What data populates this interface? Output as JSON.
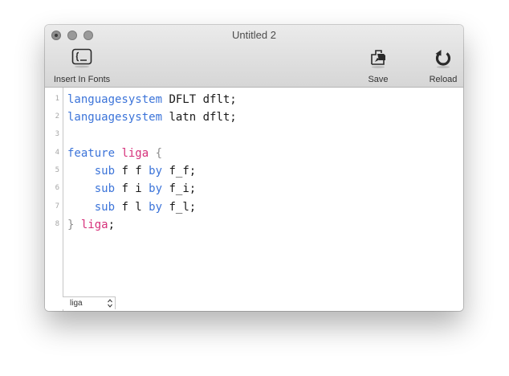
{
  "window": {
    "title": "Untitled 2"
  },
  "toolbar": {
    "insert_label": "Insert In Fonts",
    "save_label": "Save",
    "reload_label": "Reload"
  },
  "editor": {
    "line_numbers": [
      "1",
      "2",
      "3",
      "4",
      "5",
      "6",
      "7",
      "8"
    ],
    "lines": [
      [
        {
          "t": "languagesystem",
          "c": "kw"
        },
        {
          "t": " DFLT dflt;",
          "c": ""
        }
      ],
      [
        {
          "t": "languagesystem",
          "c": "kw"
        },
        {
          "t": " latn dflt;",
          "c": ""
        }
      ],
      [],
      [
        {
          "t": "feature",
          "c": "kw"
        },
        {
          "t": " ",
          "c": ""
        },
        {
          "t": "liga",
          "c": "tag"
        },
        {
          "t": " ",
          "c": ""
        },
        {
          "t": "{",
          "c": "brace"
        }
      ],
      [
        {
          "t": "    ",
          "c": ""
        },
        {
          "t": "sub",
          "c": "kw"
        },
        {
          "t": " f f ",
          "c": ""
        },
        {
          "t": "by",
          "c": "kw"
        },
        {
          "t": " f_f;",
          "c": ""
        }
      ],
      [
        {
          "t": "    ",
          "c": ""
        },
        {
          "t": "sub",
          "c": "kw"
        },
        {
          "t": " f i ",
          "c": ""
        },
        {
          "t": "by",
          "c": "kw"
        },
        {
          "t": " f_i;",
          "c": ""
        }
      ],
      [
        {
          "t": "    ",
          "c": ""
        },
        {
          "t": "sub",
          "c": "kw"
        },
        {
          "t": " f l ",
          "c": ""
        },
        {
          "t": "by",
          "c": "kw"
        },
        {
          "t": " f_l;",
          "c": ""
        }
      ],
      [
        {
          "t": "}",
          "c": "brace"
        },
        {
          "t": " ",
          "c": ""
        },
        {
          "t": "liga",
          "c": "tag"
        },
        {
          "t": ";",
          "c": ""
        }
      ]
    ]
  },
  "feature_selector": {
    "selected": "liga"
  },
  "colors": {
    "keyword": "#3c74d9",
    "tag": "#d6307a",
    "brace": "#8d8d8d"
  },
  "icons": {
    "insert": "insert-in-fonts-icon",
    "save": "save-icon",
    "reload": "reload-icon"
  }
}
